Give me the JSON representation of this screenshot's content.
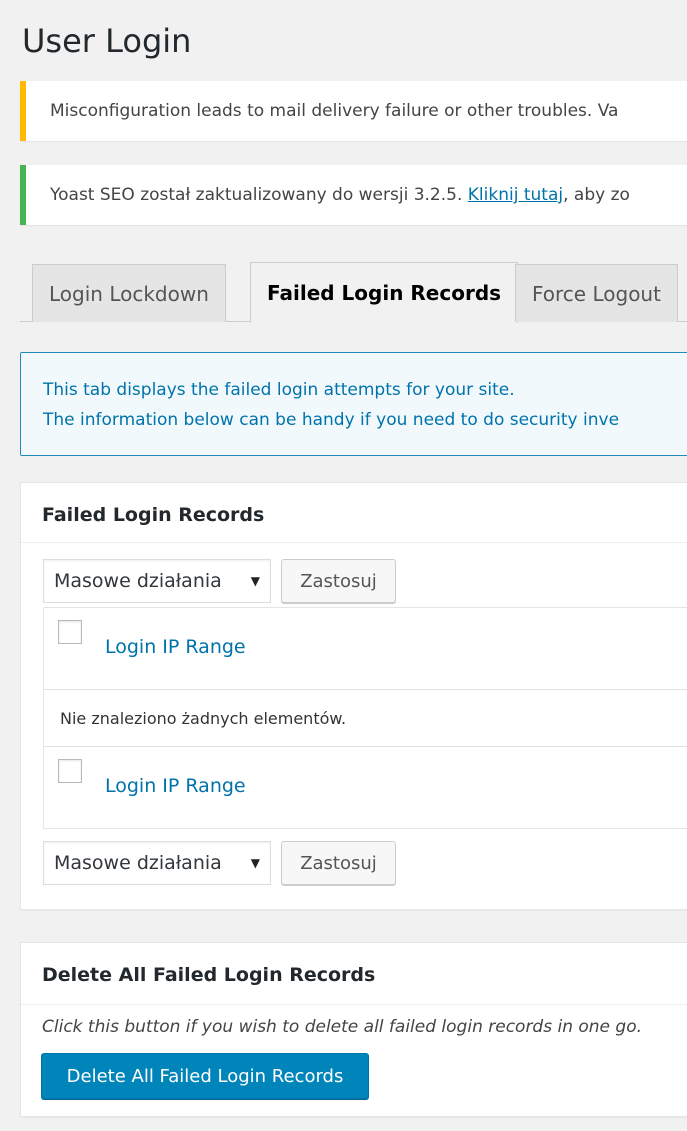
{
  "page": {
    "title": "User Login"
  },
  "notices": {
    "warning": "Misconfiguration leads to mail delivery failure or other troubles. Va",
    "success_prefix": "Yoast SEO został zaktualizowany do wersji 3.2.5. ",
    "success_link": "Kliknij tutaj",
    "success_suffix": ", aby zo"
  },
  "tabs": [
    {
      "label": "Login Lockdown",
      "active": false
    },
    {
      "label": "Failed Login Records",
      "active": true
    },
    {
      "label": "Force Logout",
      "active": false
    }
  ],
  "info": {
    "line1": "This tab displays the failed login attempts for your site.",
    "line2": "The information below can be handy if you need to do security inve"
  },
  "failed_records": {
    "heading": "Failed Login Records",
    "bulk_actions_label": "Masowe działania",
    "apply_label": "Zastosuj",
    "column_header": "Login IP Range",
    "empty_message": "Nie znaleziono żadnych elementów."
  },
  "delete_all": {
    "heading": "Delete All Failed Login Records",
    "description": "Click this button if you wish to delete all failed login records in one go.",
    "button_label": "Delete All Failed Login Records"
  },
  "colors": {
    "warning_border": "#ffb900",
    "success_border": "#46b450",
    "info_border": "#1e8cbe",
    "link": "#0073aa",
    "primary_button": "#0085ba"
  }
}
